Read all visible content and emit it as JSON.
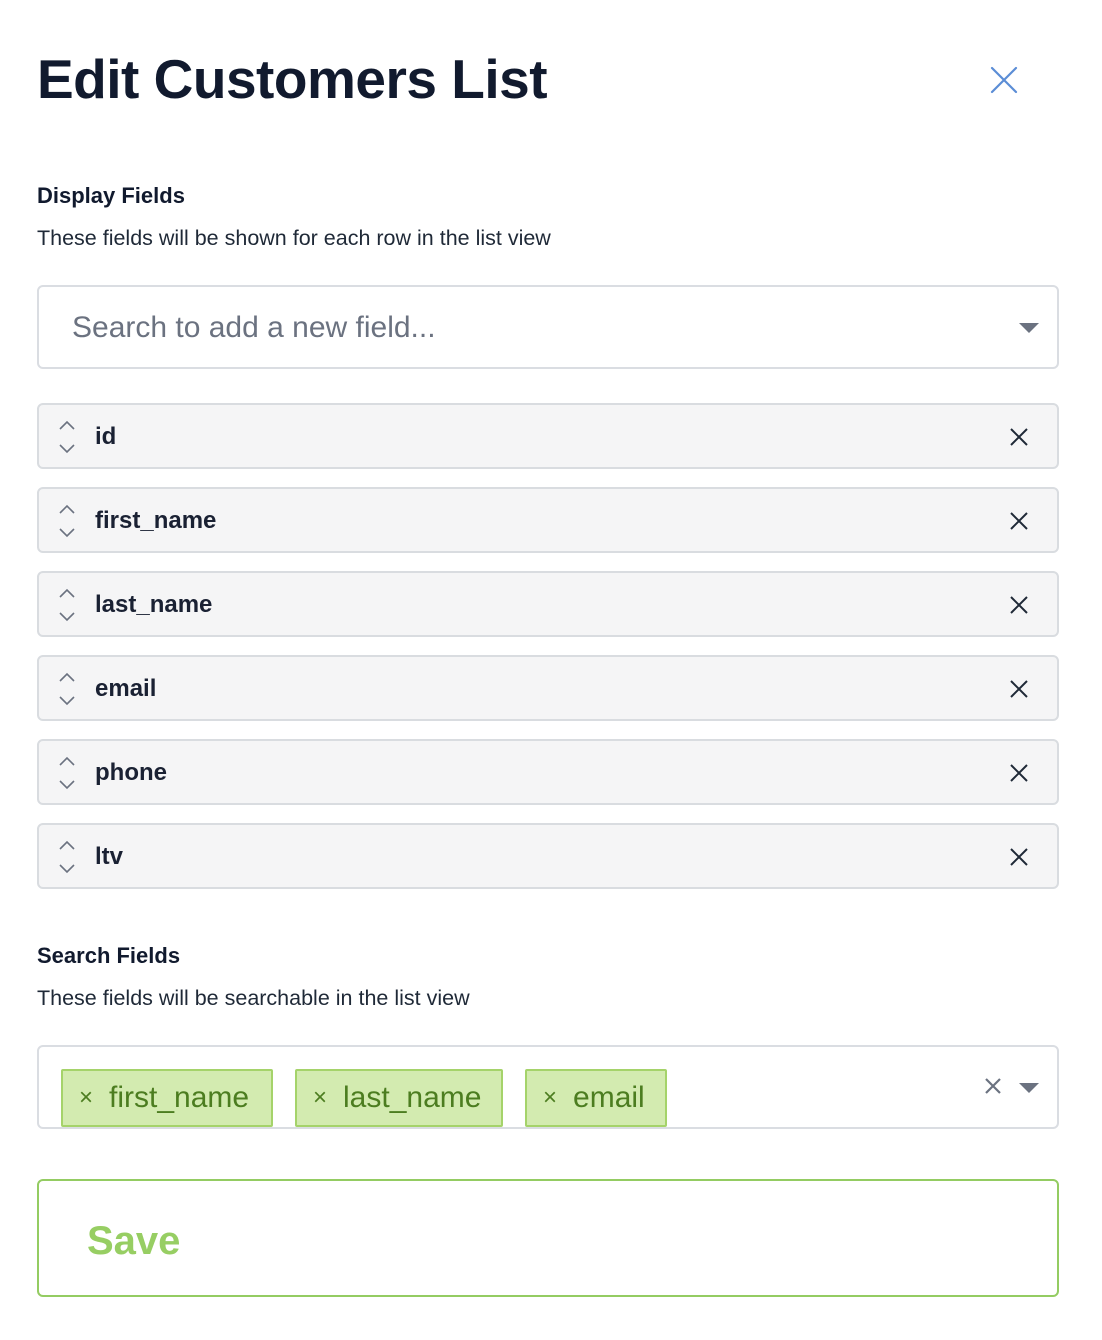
{
  "modal": {
    "title": "Edit Customers List",
    "close_icon": "close-icon"
  },
  "display_fields": {
    "label": "Display Fields",
    "description": "These fields will be shown for each row in the list view",
    "search_placeholder": "Search to add a new field...",
    "fields": [
      {
        "name": "id"
      },
      {
        "name": "first_name"
      },
      {
        "name": "last_name"
      },
      {
        "name": "email"
      },
      {
        "name": "phone"
      },
      {
        "name": "ltv"
      }
    ]
  },
  "search_fields": {
    "label": "Search Fields",
    "description": "These fields will be searchable in the list view",
    "chips": [
      {
        "label": "first_name",
        "remove": "×"
      },
      {
        "label": "last_name",
        "remove": "×"
      },
      {
        "label": "email",
        "remove": "×"
      }
    ]
  },
  "actions": {
    "save_label": "Save"
  },
  "colors": {
    "chip_bg": "#d3ebb0",
    "chip_border": "#a5d36a",
    "chip_text": "#4c7d20",
    "save_accent": "#97ce63",
    "close_icon": "#5b8dd6"
  }
}
